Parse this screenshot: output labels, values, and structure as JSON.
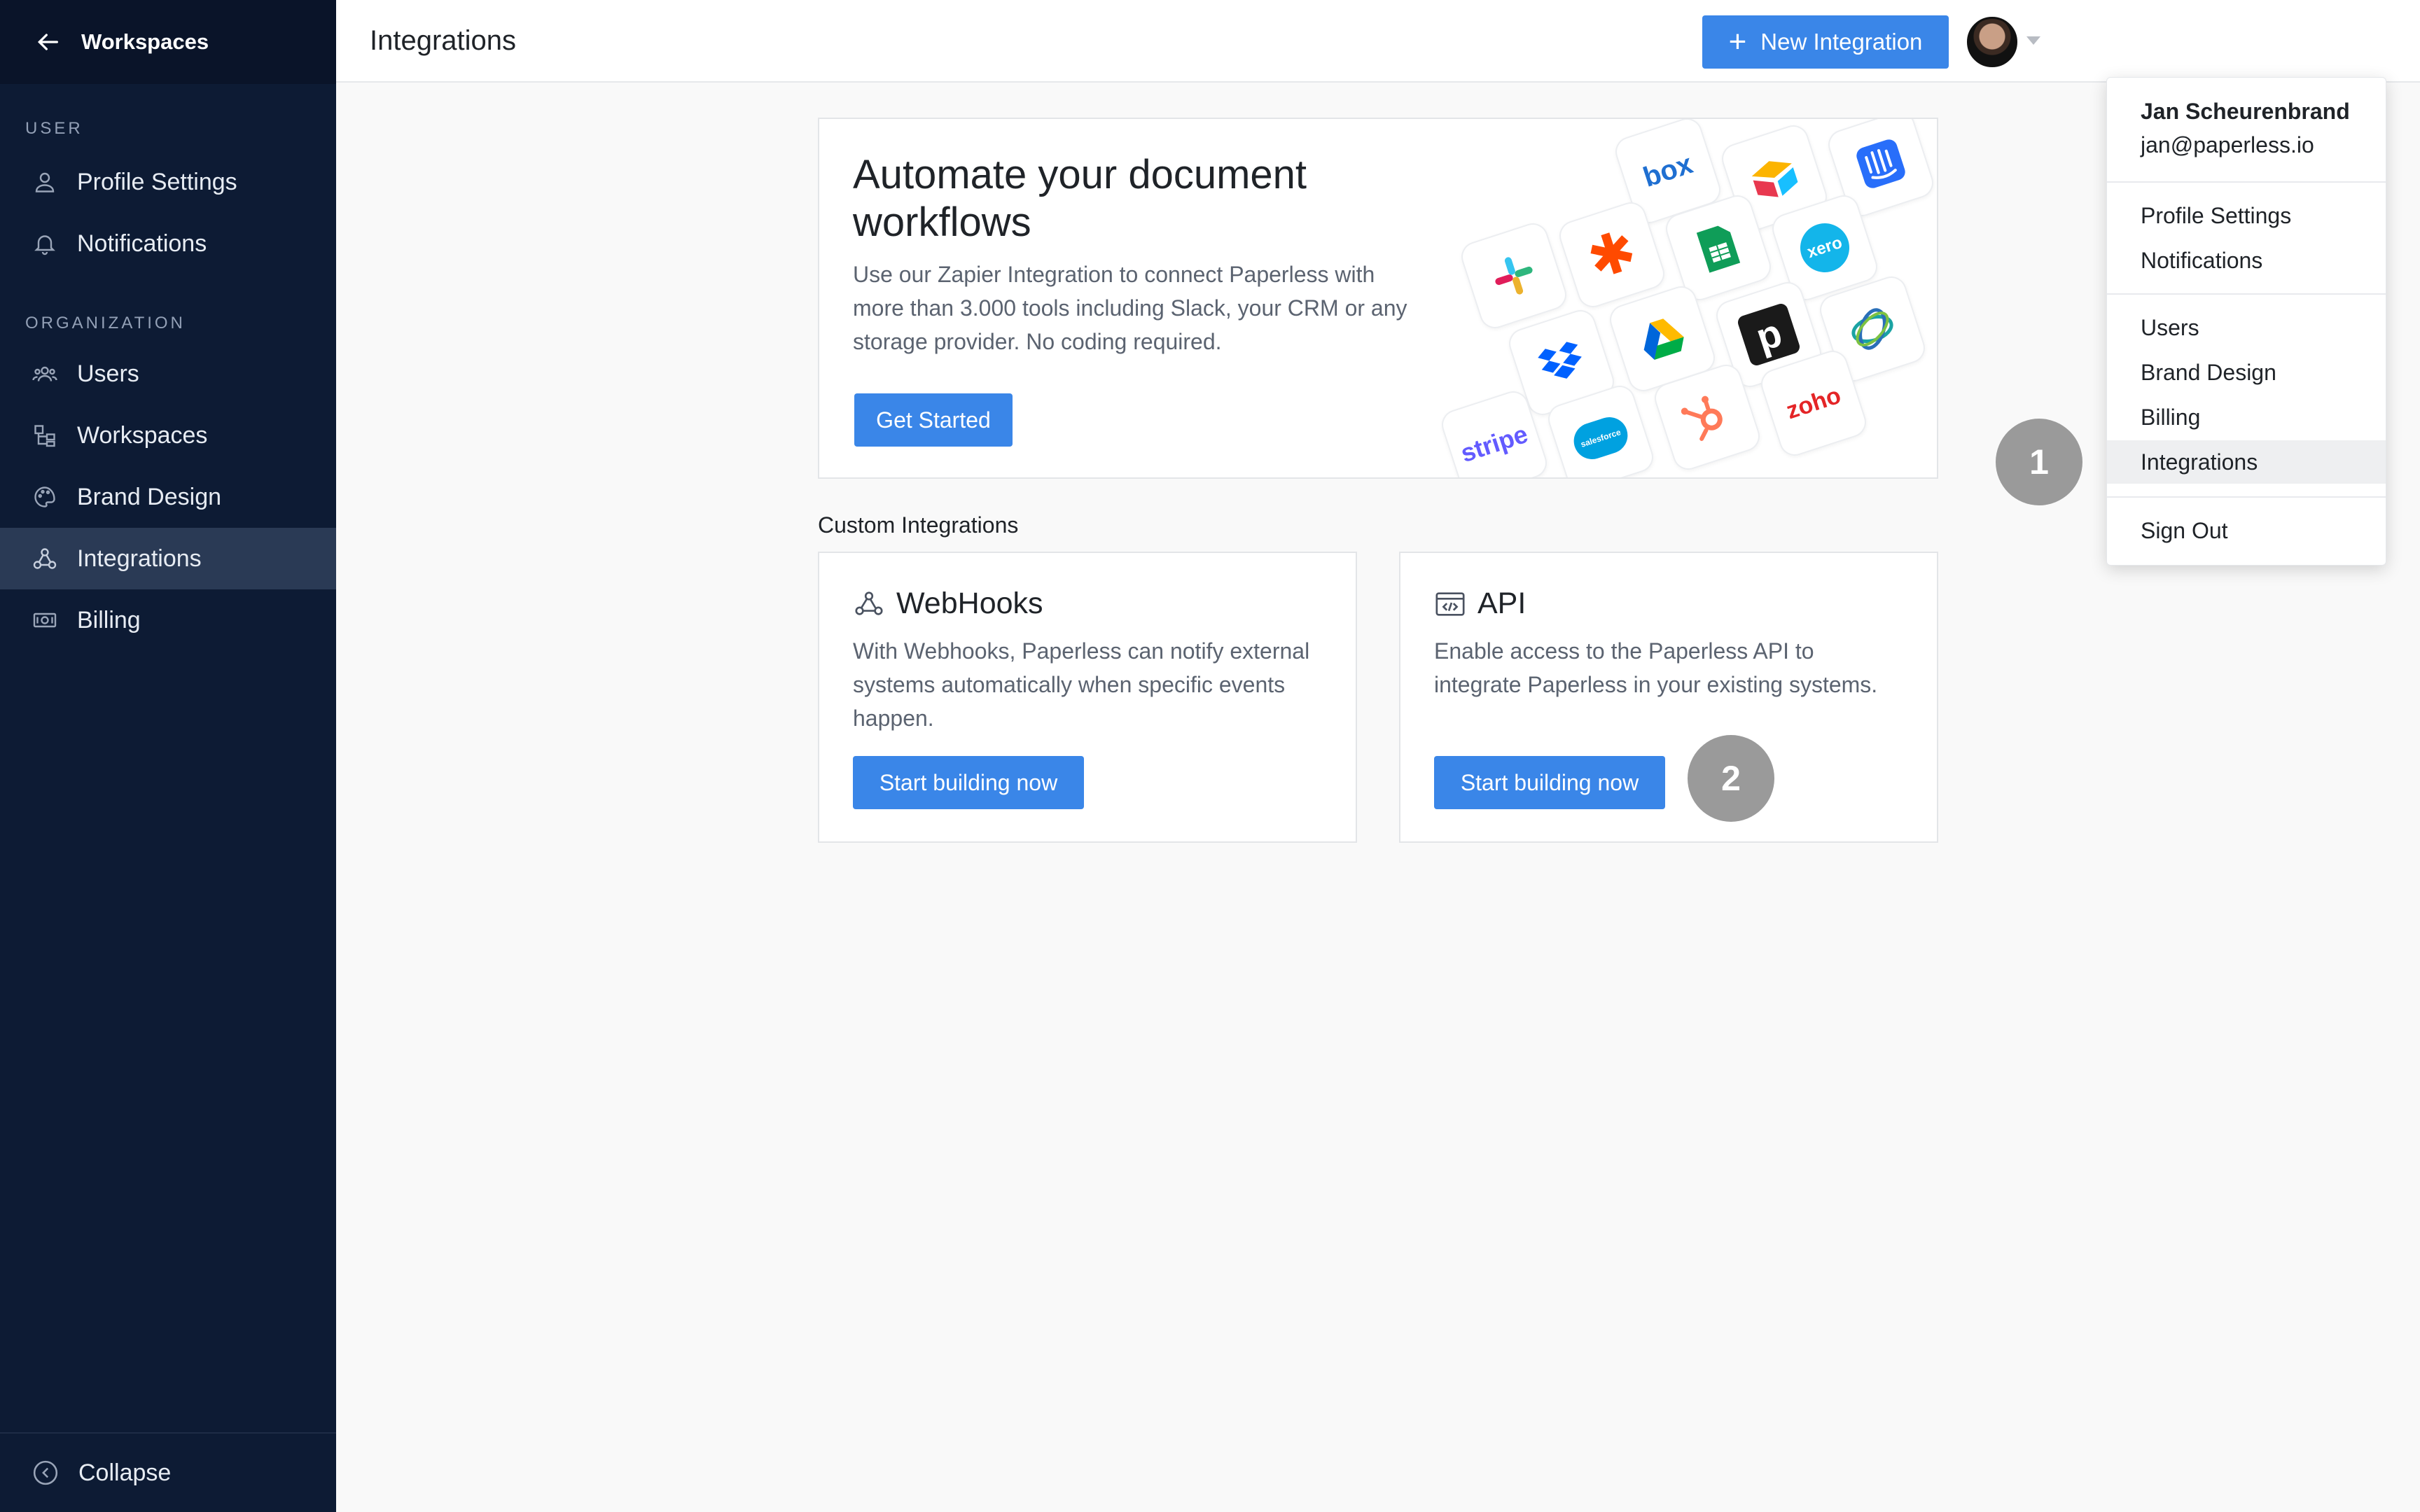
{
  "sidebar": {
    "back_label": "Workspaces",
    "user_section": "USER",
    "user_items": [
      {
        "label": "Profile Settings",
        "icon": "user-icon"
      },
      {
        "label": "Notifications",
        "icon": "bell-icon"
      }
    ],
    "org_section": "ORGANIZATION",
    "org_items": [
      {
        "label": "Users",
        "icon": "users-icon"
      },
      {
        "label": "Workspaces",
        "icon": "workspaces-icon"
      },
      {
        "label": "Brand Design",
        "icon": "palette-icon"
      },
      {
        "label": "Integrations",
        "icon": "integrations-icon",
        "active": true
      },
      {
        "label": "Billing",
        "icon": "billing-icon"
      }
    ],
    "collapse_label": "Collapse"
  },
  "header": {
    "title": "Integrations",
    "new_button": "New Integration"
  },
  "hero": {
    "title": "Automate your document workflows",
    "description": "Use our Zapier Integration to connect Paperless with more than 3.000 tools including Slack, your CRM or any storage provider. No coding required.",
    "cta": "Get Started",
    "logos": [
      "box",
      "airtable",
      "intercom",
      "slack",
      "zapier",
      "google-sheets",
      "xero",
      "dropbox",
      "google-drive",
      "pipedrive",
      "neteller",
      "stripe",
      "salesforce",
      "hubspot",
      "zoho"
    ],
    "logo_text": {
      "box": "box",
      "xero": "xero",
      "stripe": "stripe",
      "salesforce": "salesforce",
      "zoho": "zoho"
    }
  },
  "custom": {
    "section_title": "Custom Integrations",
    "webhooks": {
      "title": "WebHooks",
      "description": "With Webhooks, Paperless can notify external systems automatically when specific events happen.",
      "button": "Start building now"
    },
    "api": {
      "title": "API",
      "description": "Enable access to the Paperless API to integrate Paperless in your existing systems.",
      "button": "Start building now"
    }
  },
  "user_menu": {
    "name": "Jan Scheurenbrand",
    "email": "jan@paperless.io",
    "items_group1": [
      "Profile Settings",
      "Notifications"
    ],
    "items_group2": [
      "Users",
      "Brand Design",
      "Billing",
      "Integrations"
    ],
    "highlighted": "Integrations",
    "sign_out": "Sign Out"
  },
  "markers": [
    "1",
    "2"
  ],
  "colors": {
    "sidebar_bg": "#0d1b34",
    "accent": "#3a86e8",
    "marker": "#9a9a9a"
  }
}
